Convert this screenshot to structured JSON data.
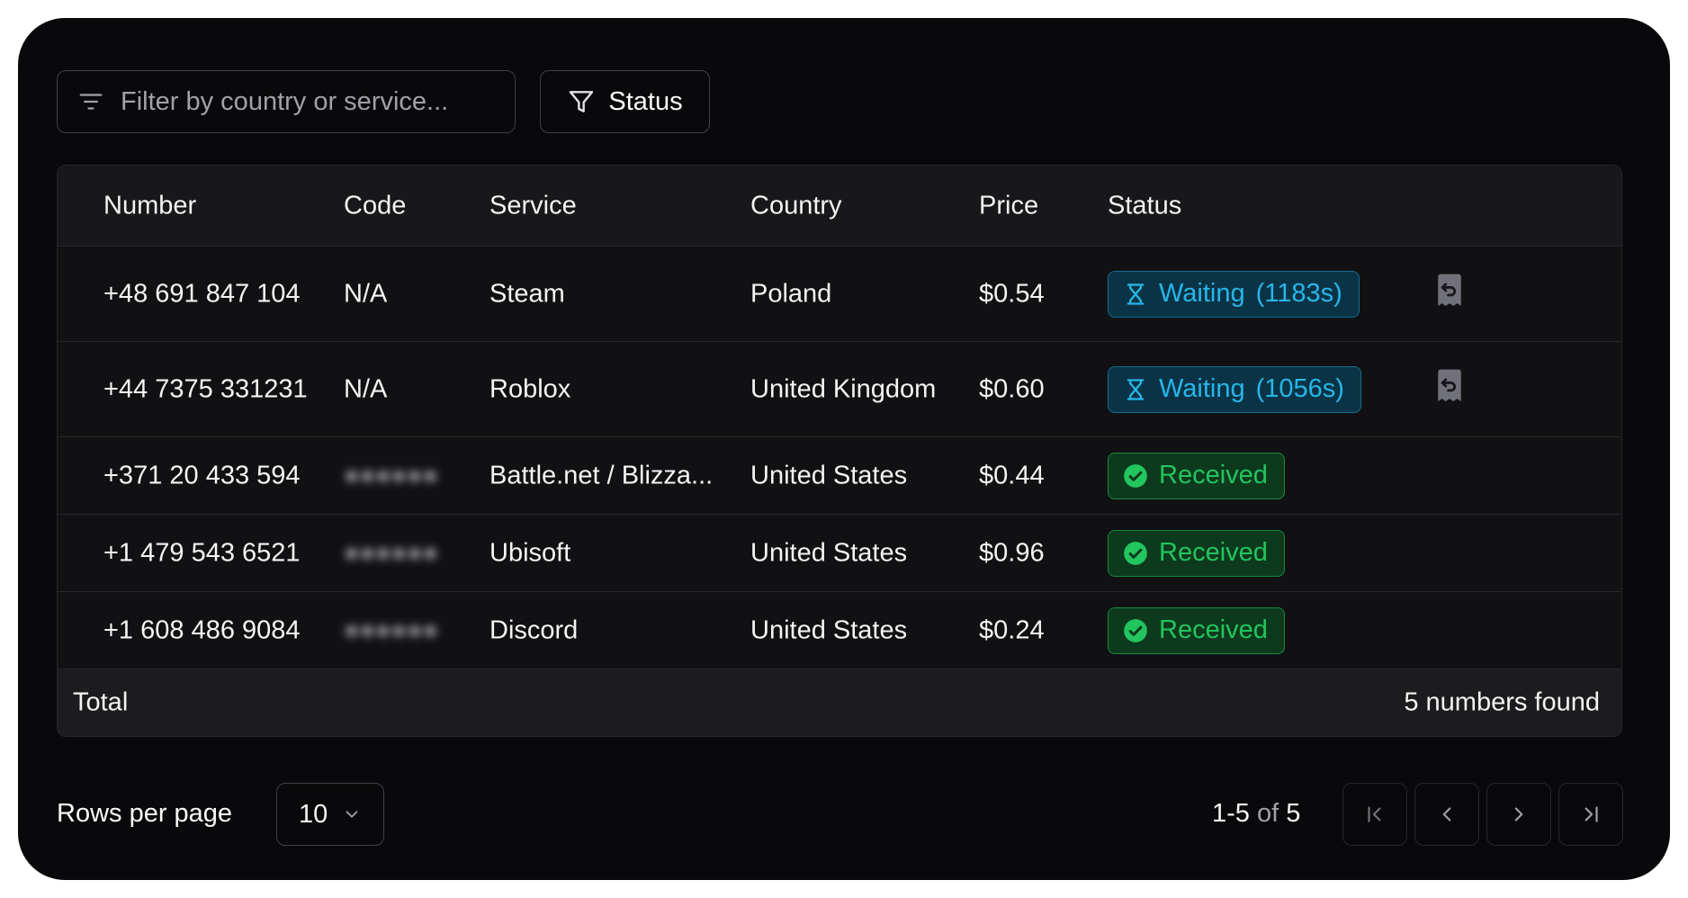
{
  "toolbar": {
    "filter_placeholder": "Filter by country or service...",
    "status_label": "Status"
  },
  "table": {
    "columns": [
      "Number",
      "Code",
      "Service",
      "Country",
      "Price",
      "Status"
    ],
    "rows": [
      {
        "number": "+48 691 847 104",
        "code": "N/A",
        "service": "Steam",
        "country": "Poland",
        "price": "$0.54",
        "status": "Waiting",
        "timer": "(1183s)"
      },
      {
        "number": "+44 7375 331231",
        "code": "N/A",
        "service": "Roblox",
        "country": "United Kingdom",
        "price": "$0.60",
        "status": "Waiting",
        "timer": "(1056s)"
      },
      {
        "number": "+371 20 433 594",
        "code": "",
        "service": "Battle.net / Blizza...",
        "country": "United States",
        "price": "$0.44",
        "status": "Received"
      },
      {
        "number": "+1 479 543 6521",
        "code": "",
        "service": "Ubisoft",
        "country": "United States",
        "price": "$0.96",
        "status": "Received"
      },
      {
        "number": "+1 608 486 9084",
        "code": "",
        "service": "Discord",
        "country": "United States",
        "price": "$0.24",
        "status": "Received"
      }
    ],
    "footer": {
      "total_label": "Total",
      "found_label": "5 numbers found"
    }
  },
  "pagination": {
    "rows_per_page_label": "Rows per page",
    "rows_per_page_value": "10",
    "range": "1-5",
    "of_label": "of",
    "total": "5"
  },
  "icons": {
    "filter": "filter-lines-icon",
    "status": "funnel-icon",
    "waiting": "hourglass-icon",
    "received": "check-circle-icon",
    "action": "receipt-refund-icon"
  },
  "colors": {
    "background": "#09090b",
    "waiting": "#27b6e8",
    "received": "#22c55e"
  }
}
